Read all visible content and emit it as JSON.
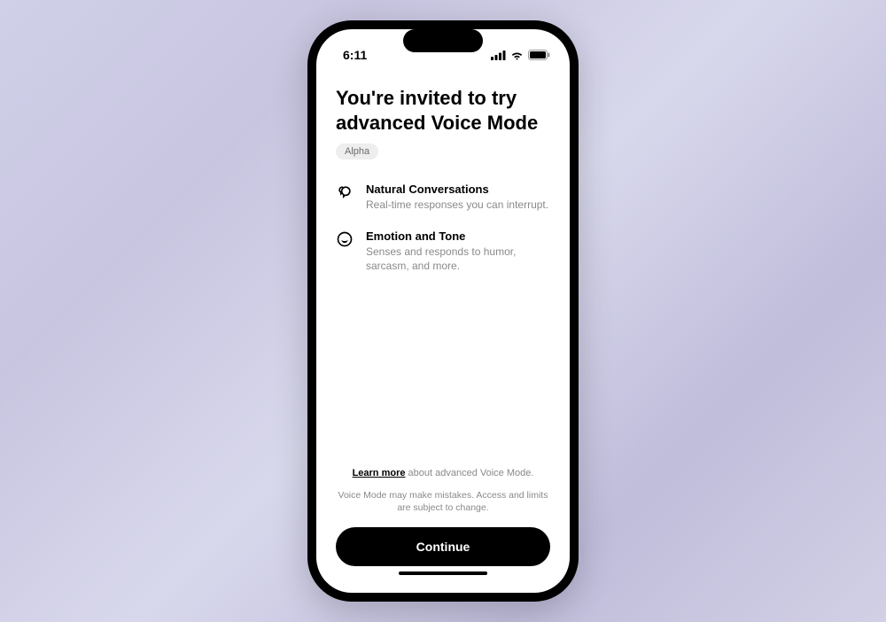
{
  "statusBar": {
    "time": "6:11"
  },
  "title": "You're invited to try advanced Voice Mode",
  "badge": "Alpha",
  "features": [
    {
      "title": "Natural Conversations",
      "desc": "Real-time responses you can interrupt."
    },
    {
      "title": "Emotion and Tone",
      "desc": "Senses and responds to humor, sarcasm, and more."
    }
  ],
  "footer": {
    "learnMoreLink": "Learn more",
    "learnMoreText": " about advanced Voice Mode.",
    "disclaimer": "Voice Mode may make mistakes. Access and limits are subject to change.",
    "continueLabel": "Continue"
  }
}
